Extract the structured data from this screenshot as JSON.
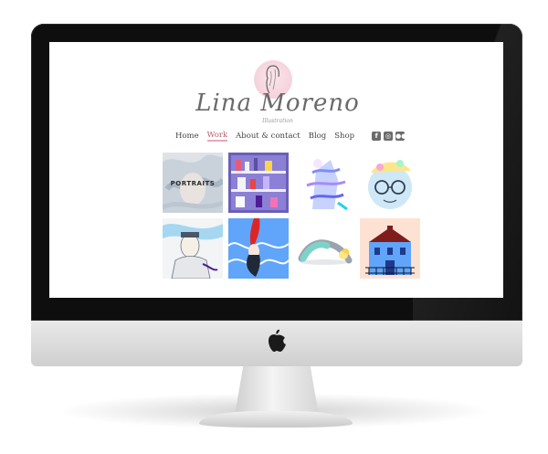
{
  "site": {
    "title": "Lina Moreno",
    "subtitle": "Illustration"
  },
  "nav": {
    "items": [
      {
        "label": "Home",
        "active": false
      },
      {
        "label": "Work",
        "active": true
      },
      {
        "label": "About & contact",
        "active": false
      },
      {
        "label": "Blog",
        "active": false
      },
      {
        "label": "Shop",
        "active": false
      }
    ],
    "social": [
      "facebook-icon",
      "instagram-icon",
      "flickr-icon"
    ]
  },
  "gallery": {
    "overlay_label": "PORTRAITS",
    "tiles": [
      "portraits-illustration",
      "shelves-illustration",
      "stacked-figures-illustration",
      "glasses-face-illustration",
      "man-portrait-illustration",
      "hanging-hair-illustration",
      "yoga-pose-illustration",
      "blue-house-illustration"
    ]
  },
  "colors": {
    "accent": "#b65b6e",
    "text": "#444444",
    "bezel": "#0e0e0e"
  }
}
